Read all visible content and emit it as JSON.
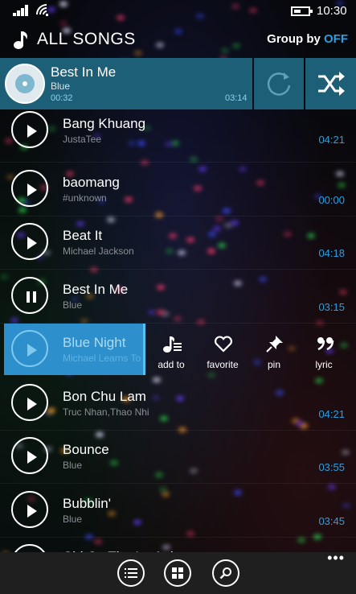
{
  "status": {
    "time": "10:30"
  },
  "header": {
    "title": "ALL SONGS",
    "group_by_label": "Group by",
    "group_by_value": "OFF"
  },
  "now_playing": {
    "title": "Best In Me",
    "artist": "Blue",
    "elapsed": "00:32",
    "duration": "03:14"
  },
  "songs": [
    {
      "title": "Bang Khuang",
      "artist": "JustaTee",
      "duration": "04:21",
      "state": "play"
    },
    {
      "title": "baomang",
      "artist": "#unknown",
      "duration": "00:00",
      "state": "play"
    },
    {
      "title": "Beat It",
      "artist": "Michael Jackson",
      "duration": "04:18",
      "state": "play"
    },
    {
      "title": "Best In Me",
      "artist": "Blue",
      "duration": "03:15",
      "state": "pause"
    },
    {
      "title": "Blue Night",
      "artist": "Michael Learns To Rock",
      "duration": "",
      "state": "play"
    },
    {
      "title": "Bon Chu Lam",
      "artist": "Truc Nhan,Thao Nhi",
      "duration": "04:21",
      "state": "play"
    },
    {
      "title": "Bounce",
      "artist": "Blue",
      "duration": "03:55",
      "state": "play"
    },
    {
      "title": "Bubblin'",
      "artist": " Blue",
      "duration": "03:45",
      "state": "play"
    },
    {
      "title": "Chi Co The La Anh",
      "artist": "",
      "duration": "",
      "state": "play"
    }
  ],
  "row_actions": [
    {
      "label": "add to",
      "icon": "add-to-playlist-icon"
    },
    {
      "label": "favorite",
      "icon": "heart-icon"
    },
    {
      "label": "pin",
      "icon": "pin-icon"
    },
    {
      "label": "lyric",
      "icon": "quote-icon"
    }
  ],
  "appbar": {
    "more": "•••"
  },
  "colors": {
    "accent": "#2a9fe0",
    "now_playing_bg": "#1d5f77",
    "selected_bg": "#2d8fcc"
  }
}
